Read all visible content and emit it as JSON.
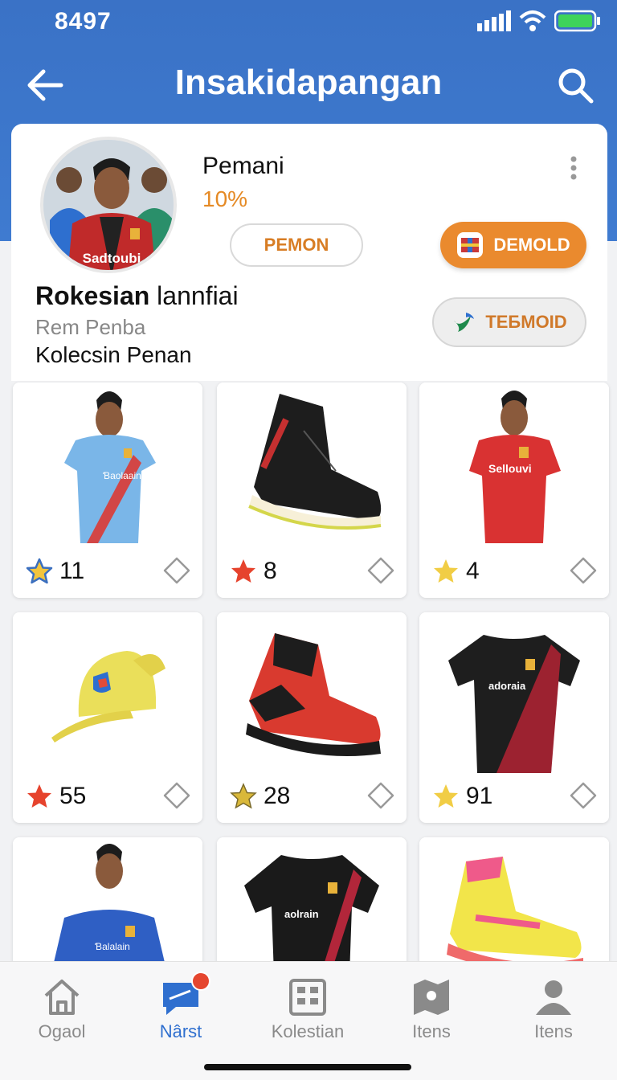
{
  "status_bar": {
    "time": "8497"
  },
  "header": {
    "title": "Insakidapangan"
  },
  "profile": {
    "avatar_jersey_text": "Sadtoubi",
    "name": "Pemani",
    "percent": "10%",
    "title_bold": "Rokesian",
    "title_rest": " lannfiai",
    "subtitle": "Rem Penba",
    "collection": "Kolecsin Penan",
    "buttons": {
      "pemon": "PEMON",
      "demold": "DEMOLD",
      "tebmoid": "TEБMOID"
    }
  },
  "grid": {
    "items": [
      {
        "type": "jersey-model",
        "count": "11",
        "star": "blue"
      },
      {
        "type": "shoe-black",
        "count": "8",
        "star": "red"
      },
      {
        "type": "jersey-model-red",
        "count": "4",
        "star": "gold"
      },
      {
        "type": "cap",
        "count": "55",
        "star": "red"
      },
      {
        "type": "shoe-red",
        "count": "28",
        "star": "gold"
      },
      {
        "type": "jersey-black-red",
        "count": "91",
        "star": "gold"
      },
      {
        "type": "jersey-model-blue",
        "count": "",
        "star": ""
      },
      {
        "type": "jersey-black",
        "count": "",
        "star": ""
      },
      {
        "type": "shoe-yellow",
        "count": "",
        "star": ""
      }
    ]
  },
  "bottom_nav": {
    "items": [
      {
        "label": "Ogaol",
        "icon": "home-icon",
        "active": false
      },
      {
        "label": "Nârst",
        "icon": "message-icon",
        "active": true
      },
      {
        "label": "Kolestian",
        "icon": "grid-icon",
        "active": false
      },
      {
        "label": "Itens",
        "icon": "map-icon",
        "active": false
      },
      {
        "label": "Itens",
        "icon": "profile-icon",
        "active": false
      }
    ]
  },
  "colors": {
    "header": "#3a72c6",
    "accent_orange": "#ea8a2e",
    "active_nav": "#2f6fcf"
  }
}
